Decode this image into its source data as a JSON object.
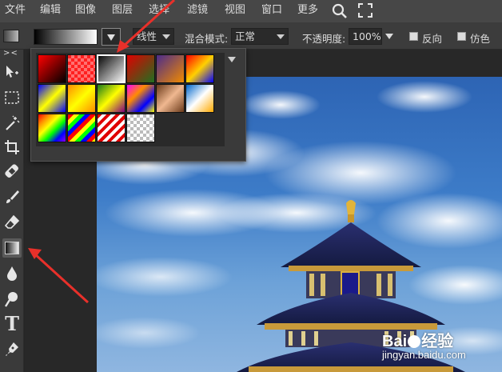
{
  "menu": {
    "items": [
      "文件",
      "编辑",
      "图像",
      "图层",
      "选择",
      "滤镜",
      "视图",
      "窗口",
      "更多"
    ],
    "icons": [
      "search-icon",
      "fullscreen-icon"
    ]
  },
  "options": {
    "gradient_type_value": "线性",
    "blend_label": "混合模式:",
    "blend_value": "正常",
    "opacity_label": "不透明度:",
    "opacity_value": "100%",
    "reverse_label": "反向",
    "dither_label": "仿色"
  },
  "toolbar": {
    "tools": [
      "move-tool-icon",
      "marquee-tool-icon",
      "magic-wand-icon",
      "crop-tool-icon",
      "healing-brush-icon",
      "brush-tool-icon",
      "eraser-tool-icon",
      "gradient-tool-icon",
      "blur-tool-icon",
      "dodge-tool-icon",
      "type-tool-icon",
      "pen-tool-icon"
    ],
    "text_tool_glyph": "T",
    "collapse_glyph": "> <"
  },
  "gradient_picker": {
    "swatches": [
      "linear-gradient(135deg,#ff0000 0%,#000000 100%)",
      "repeating-conic-gradient(#ff7070 0% 25%, #ff2020 0% 50%) 0 0/8px 8px",
      "linear-gradient(135deg,#000000 0%,#ffffff 100%)",
      "linear-gradient(135deg,#e00000 0%,#207020 100%)",
      "linear-gradient(135deg,#4b2b8c 0%,#f08a00 100%)",
      "linear-gradient(135deg,#ff0000 0%,#ffd000 50%,#0000ff 100%)",
      "linear-gradient(135deg,#0000ff 0%,#ffff00 50%,#0000ff 100%)",
      "linear-gradient(135deg,#ff8c00 0%,#ffff00 50%,#ff8c00 100%)",
      "linear-gradient(135deg,#1a7a1a 0%,#ffff00 50%,#800080 100%)",
      "linear-gradient(135deg,#ff00ff 0%,#ff8c00 35%,#0000ff 70%,#ffff00 100%)",
      "linear-gradient(135deg,#6b3a1a 0%,#f0b890 50%,#6b3a1a 100%)",
      "linear-gradient(135deg,#0066cc 0%,#ffffff 50%,#ffaa00 100%)",
      "linear-gradient(135deg,#ff0000,#ff8c00,#ffff00,#00ff00,#0000ff,#8b00ff)",
      "repeating-linear-gradient(135deg,#ff0000 0 5px,#ffff00 5px 10px,#00ff00 10px 15px,#0000ff 15px 20px)",
      "repeating-linear-gradient(135deg,#e00000 0 4px,#ffffff 4px 8px)",
      "repeating-conic-gradient(#bbbbbb 0% 25%, #ffffff 0% 50%) 0 0/8px 8px"
    ],
    "selected_index": 2
  },
  "watermark": {
    "brand": "Bai",
    "brand_suffix": "经验",
    "url": "jingyan.baidu.com"
  },
  "colors": {
    "annotation_red": "#e8302a",
    "panel_bg": "#3a3a3a",
    "menubar_bg": "#474747"
  }
}
